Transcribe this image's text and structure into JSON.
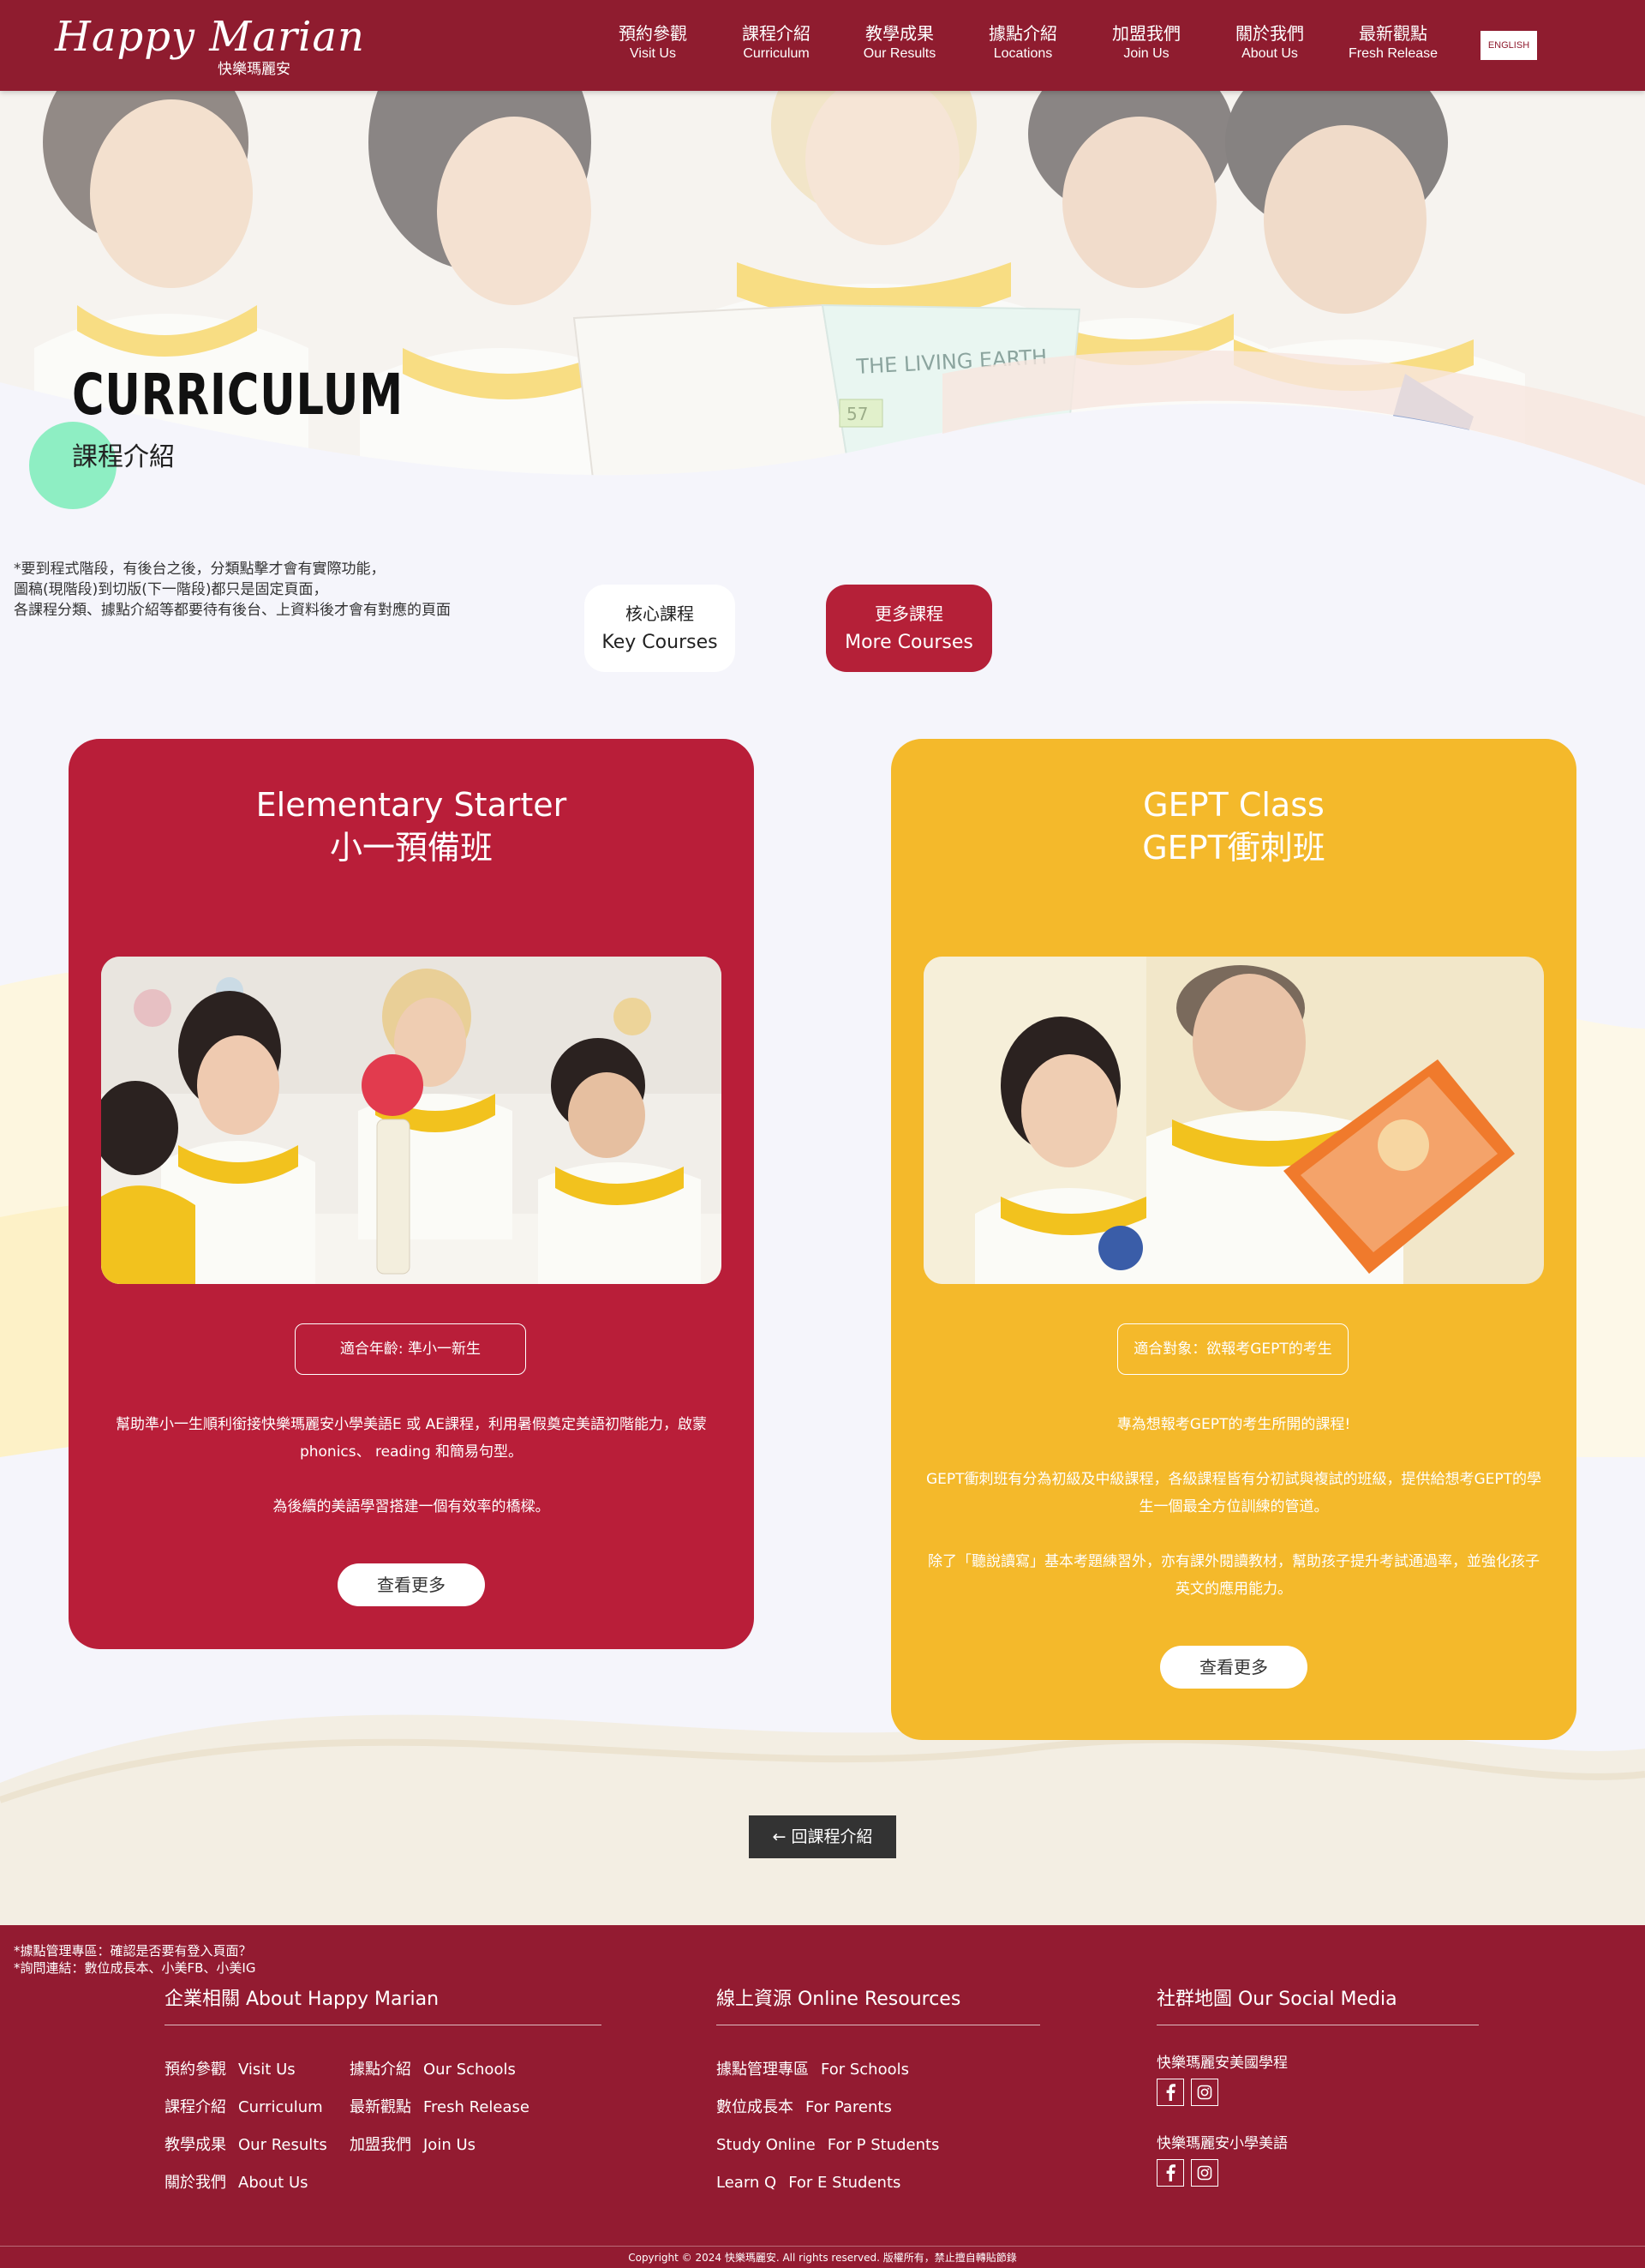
{
  "header": {
    "logo_script": "Happy Marian",
    "logo_sub": "快樂瑪麗安",
    "nav": [
      {
        "zh": "預約參觀",
        "en": "Visit Us"
      },
      {
        "zh": "課程介紹",
        "en": "Curriculum"
      },
      {
        "zh": "教學成果",
        "en": "Our Results"
      },
      {
        "zh": "據點介紹",
        "en": "Locations"
      },
      {
        "zh": "加盟我們",
        "en": "Join Us"
      },
      {
        "zh": "關於我們",
        "en": "About Us"
      },
      {
        "zh": "最新觀點",
        "en": "Fresh Release"
      }
    ],
    "lang_button": "ENGLISH"
  },
  "hero": {
    "title": "CURRICULUM",
    "subtitle": "課程介紹",
    "book_text": "THE LIVING EARTH",
    "book_num": "57"
  },
  "dev_note": "*要到程式階段，有後台之後，分類點擊才會有實際功能，\n圖稿(現階段)到切版(下一階段)都只是固定頁面，\n各課程分類、據點介紹等都要待有後台、上資料後才會有對應的頁面",
  "tabs": [
    {
      "zh": "核心課程",
      "en": "Key Courses"
    },
    {
      "zh": "更多課程",
      "en": "More Courses"
    }
  ],
  "cards": [
    {
      "title_en": "Elementary Starter",
      "title_zh": "小一預備班",
      "tag": "適合年齡: 準小一新生",
      "paragraphs": [
        "幫助準小一生順利銜接快樂瑪麗安小學美語E 或 AE課程，利用暑假奠定美語初階能力，啟蒙 phonics、 reading 和簡易句型。",
        "為後續的美語學習搭建一個有效率的橋樑。"
      ],
      "button": "查看更多"
    },
    {
      "title_en": "GEPT Class",
      "title_zh": "GEPT衝刺班",
      "tag": "適合對象：欲報考GEPT的考生",
      "paragraphs": [
        "專為想報考GEPT的考生所開的課程!",
        "GEPT衝刺班有分為初級及中級課程，各級課程皆有分初試與複試的班級，提供給想考GEPT的學生一個最全方位訓練的管道。",
        "除了「聽說讀寫」基本考題練習外，亦有課外閱讀教材，幫助孩子提升考試通過率，並強化孩子英文的應用能力。"
      ],
      "button": "查看更多"
    }
  ],
  "back_button": "← 回課程介紹",
  "footer": {
    "note": "*據點管理專區：確認是否要有登入頁面？\n*詢問連結：數位成長本、小美FB、小美IG",
    "col1_title": "企業相關 About Happy Marian",
    "col1_links": [
      {
        "zh": "預約參觀",
        "en": "Visit Us"
      },
      {
        "zh": "據點介紹",
        "en": "Our Schools"
      },
      {
        "zh": "課程介紹",
        "en": "Curriculum"
      },
      {
        "zh": "最新觀點",
        "en": "Fresh Release"
      },
      {
        "zh": "教學成果",
        "en": "Our Results"
      },
      {
        "zh": "加盟我們",
        "en": "Join Us"
      },
      {
        "zh": "關於我們",
        "en": "About Us"
      }
    ],
    "col2_title": "線上資源 Online Resources",
    "col2_links": [
      {
        "zh": "據點管理專區",
        "en": "For Schools"
      },
      {
        "zh": "數位成長本",
        "en": "For Parents"
      },
      {
        "zh": "Study Online",
        "en": "For P Students"
      },
      {
        "zh": "Learn Q",
        "en": "For E Students"
      }
    ],
    "col3_title": "社群地圖 Our Social Media",
    "social_groups": [
      {
        "label": "快樂瑪麗安美國學程"
      },
      {
        "label": "快樂瑪麗安小學美語"
      }
    ],
    "copyright": "Copyright © 2024 快樂瑪麗安. All rights reserved. 版權所有，禁止擅自轉貼節錄"
  },
  "colors": {
    "brand_red": "#8f1c2f",
    "card_red": "#b91e39",
    "card_yellow": "#f4b92b",
    "mint": "#8eeec3"
  }
}
